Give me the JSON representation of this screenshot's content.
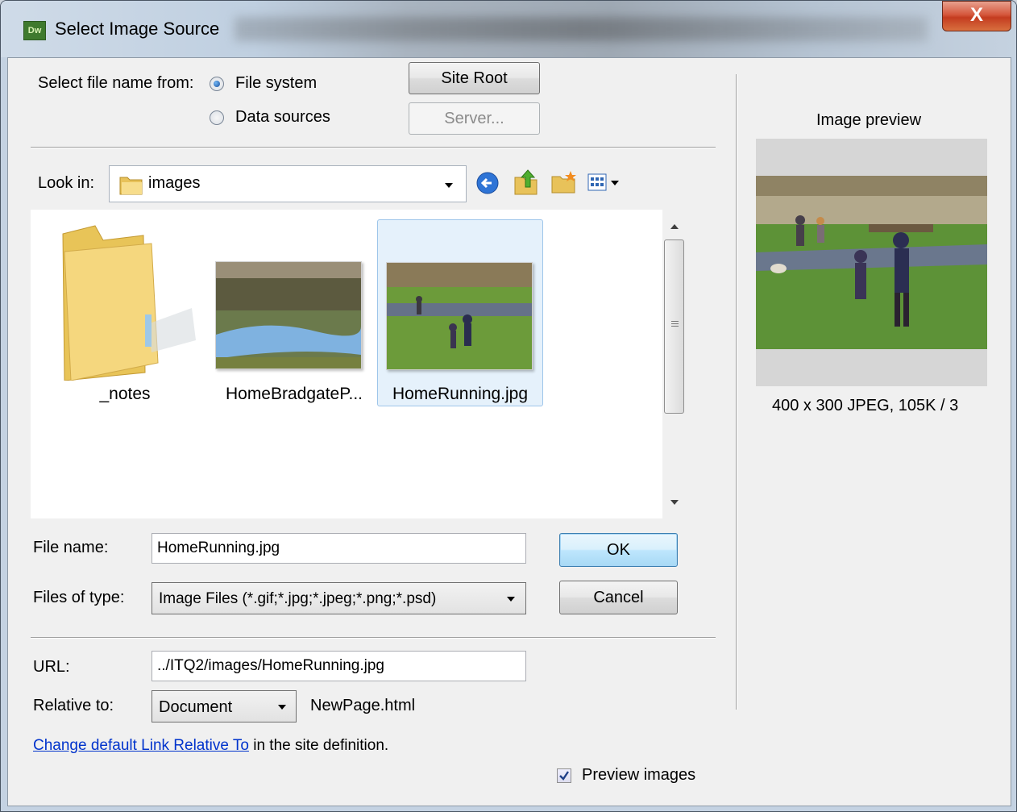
{
  "window": {
    "title": "Select Image Source",
    "app_icon_text": "Dw",
    "close_label": "X"
  },
  "source": {
    "label": "Select file name from:",
    "options": [
      "File system",
      "Data sources"
    ],
    "selected": "File system",
    "site_root_label": "Site Root",
    "server_label": "Server..."
  },
  "lookin": {
    "label": "Look in:",
    "folder": "images"
  },
  "toolbar_icons": [
    "back-icon",
    "up-folder-icon",
    "new-folder-icon",
    "view-menu-icon"
  ],
  "files": [
    {
      "name": "_notes",
      "type": "folder",
      "selected": false
    },
    {
      "name": "HomeBradgateP...",
      "type": "image",
      "selected": false
    },
    {
      "name": "HomeRunning.jpg",
      "type": "image",
      "selected": true
    }
  ],
  "form": {
    "file_name_label": "File name:",
    "file_name_value": "HomeRunning.jpg",
    "files_of_type_label": "Files of type:",
    "files_of_type_value": "Image Files (*.gif;*.jpg;*.jpeg;*.png;*.psd)",
    "ok_label": "OK",
    "cancel_label": "Cancel",
    "url_label": "URL:",
    "url_value": "../ITQ2/images/HomeRunning.jpg",
    "relative_label": "Relative to:",
    "relative_value": "Document",
    "relative_page": "NewPage.html",
    "link_text": "Change default Link Relative To",
    "link_suffix": " in the site definition.",
    "preview_images_label": "Preview images",
    "preview_images_checked": true
  },
  "preview": {
    "title": "Image preview",
    "info": "400 x 300 JPEG, 105K / 3"
  }
}
